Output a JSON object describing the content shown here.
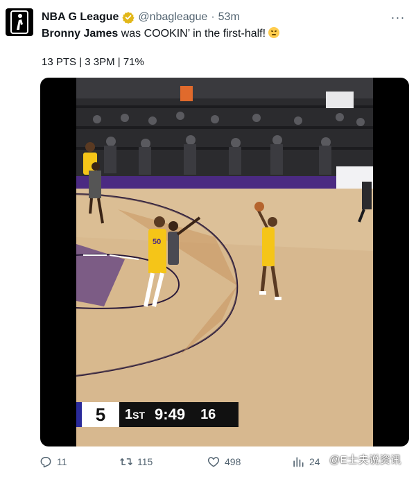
{
  "header": {
    "display_name": "NBA G League",
    "handle": "@nbagleague",
    "separator": "·",
    "time": "53m",
    "more_label": "···"
  },
  "tweet": {
    "name_part": "Bronny James",
    "text_part": " was COOKIN’ in the first-half!",
    "emoji": "face-with-steam-emoji",
    "stats_line": "13 PTS | 3 3PM | 71%"
  },
  "video": {
    "score": "5",
    "quarter_num": "1",
    "quarter_suffix": "ST",
    "clock": "9:49",
    "shot_clock": "16",
    "jersey_number": "50"
  },
  "actions": {
    "replies": "11",
    "retweets": "115",
    "likes": "498",
    "views": "24"
  },
  "watermark": "@E士夫说资讯",
  "colors": {
    "text_primary": "#0f1419",
    "text_secondary": "#536471",
    "verified_gold": "#e2b719",
    "lakers_gold": "#f5c518",
    "court_purple": "#4b2a82"
  }
}
